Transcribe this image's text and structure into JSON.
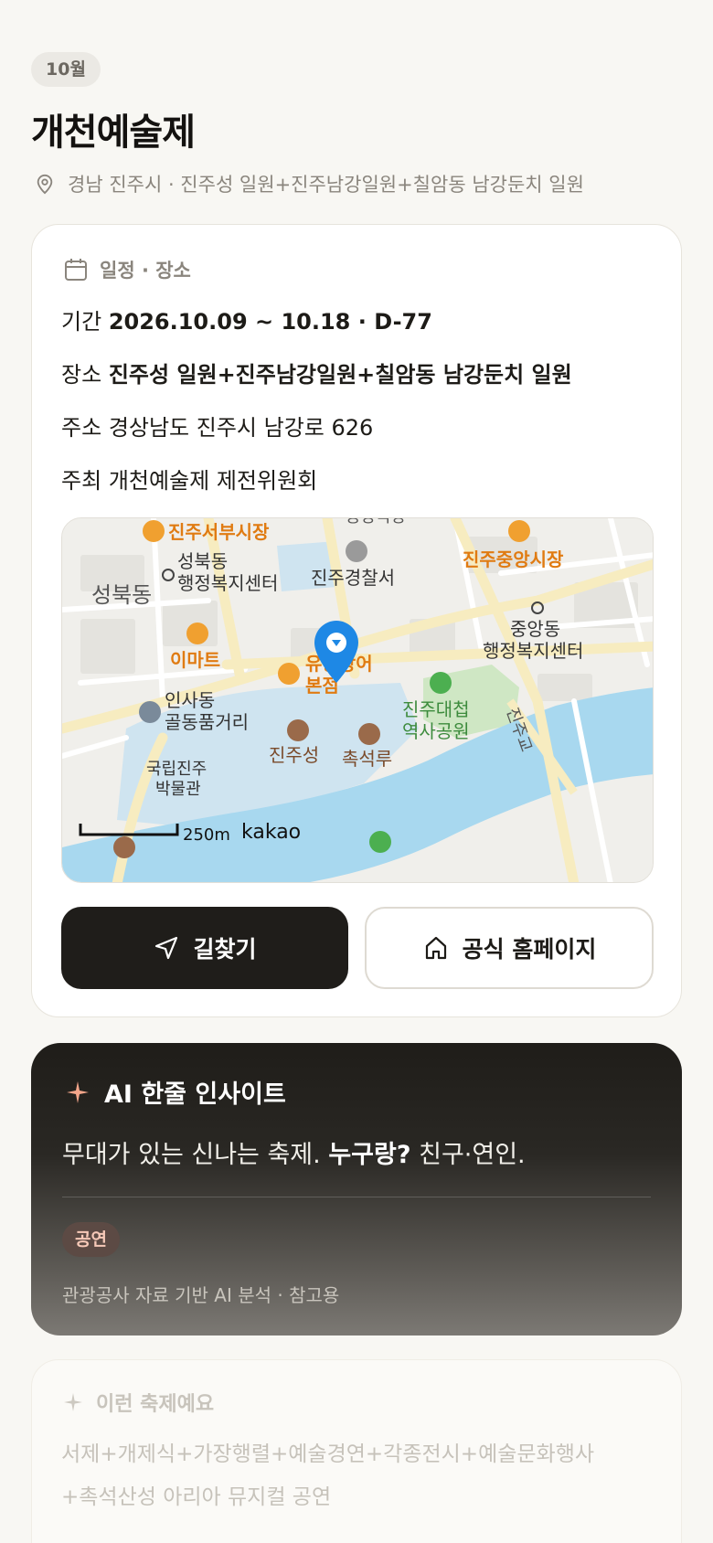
{
  "header": {
    "month": "10월",
    "title": "개천예술제",
    "location": "경남 진주시 · 진주성 일원+진주남강일원+칠암동 남강둔치 일원"
  },
  "schedule": {
    "heading": "일정 · 장소",
    "period_label": "기간",
    "period_value": "2026.10.09 ~ 10.18 · D-77",
    "venue_label": "장소",
    "venue_value": "진주성 일원+진주남강일원+칠암동 남강둔치 일원",
    "address_label": "주소",
    "address_value": "경상남도 진주시 남강로 626",
    "host_label": "주최",
    "host_value": "개천예술제 제전위원회"
  },
  "map": {
    "labels": {
      "seobu_market": "진주서부시장",
      "seongbuk_center_1": "성북동",
      "seongbuk_center_2": "행정복지센터",
      "seongbuk_dong": "성북동",
      "police": "진주경찰서",
      "jungang_market": "진주중앙시장",
      "jungang_center_1": "중앙동",
      "jungang_center_2": "행정복지센터",
      "emart": "이마트",
      "restaurant_1": "유등장어",
      "restaurant_2": "본점",
      "insadong_1": "인사동",
      "insadong_2": "골동품거리",
      "daecheop_1": "진주대첩",
      "daecheop_2": "역사공원",
      "jinju_bridge": "진주교",
      "museum_1": "국립진주",
      "museum_2": "박물관",
      "jinjuseong": "진주성",
      "chokseoknu": "촉석루",
      "top_cut": "중앙극장"
    },
    "scale": "250m",
    "brand": "kakao",
    "colors": {
      "water": "#a8d8ef",
      "park": "#cfe7c4",
      "road": "#ffffff",
      "major_road": "#f7ecc0",
      "poi_orange": "#e07b12",
      "poi_brown": "#9a6a4a",
      "pin": "#1e88e5"
    }
  },
  "actions": {
    "directions": "길찾기",
    "homepage": "공식 홈페이지"
  },
  "ai": {
    "heading": "AI 한줄 인사이트",
    "text_main": "무대가 있는 신나는 축제.",
    "text_question": "누구랑?",
    "text_answer": "친구·연인.",
    "tag": "공연",
    "note": "관광공사 자료 기반 AI 분석 · 참고용"
  },
  "description": {
    "heading": "이런 축제예요",
    "line1": "서제+개제식+가장행렬+예술경연+각종전시+예술문화행사",
    "line2": "+촉석산성 아리아 뮤지컬 공연"
  }
}
